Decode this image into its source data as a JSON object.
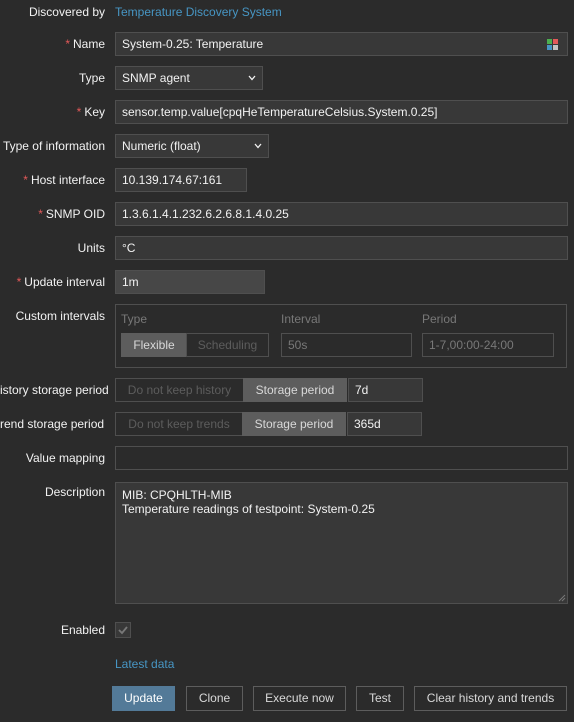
{
  "form": {
    "discovered_by": {
      "label": "Discovered by",
      "value": "Temperature Discovery System"
    },
    "name": {
      "label": "Name",
      "value": "System-0.25: Temperature"
    },
    "type": {
      "label": "Type",
      "value": "SNMP agent"
    },
    "key": {
      "label": "Key",
      "value": "sensor.temp.value[cpqHeTemperatureCelsius.System.0.25]"
    },
    "type_of_information": {
      "label": "Type of information",
      "value": "Numeric (float)"
    },
    "host_interface": {
      "label": "Host interface",
      "value": "10.139.174.67:161"
    },
    "snmp_oid": {
      "label": "SNMP OID",
      "value": "1.3.6.1.4.1.232.6.2.6.8.1.4.0.25"
    },
    "units": {
      "label": "Units",
      "value": "°C"
    },
    "update_interval": {
      "label": "Update interval",
      "value": "1m"
    },
    "custom_intervals": {
      "label": "Custom intervals",
      "headers": {
        "type": "Type",
        "interval": "Interval",
        "period": "Period"
      },
      "type_options": [
        "Flexible",
        "Scheduling"
      ],
      "interval_value": "50s",
      "period_value": "1-7,00:00-24:00"
    },
    "history_storage": {
      "label": "istory storage period",
      "options": [
        "Do not keep history",
        "Storage period"
      ],
      "value": "7d"
    },
    "trend_storage": {
      "label": "rend storage period",
      "options": [
        "Do not keep trends",
        "Storage period"
      ],
      "value": "365d"
    },
    "value_mapping": {
      "label": "Value mapping",
      "value": ""
    },
    "description": {
      "label": "Description",
      "value": "MIB: CPQHLTH-MIB\nTemperature readings of testpoint: System-0.25"
    },
    "enabled": {
      "label": "Enabled",
      "checked": true
    },
    "latest_data_link": "Latest data"
  },
  "buttons": {
    "update": "Update",
    "clone": "Clone",
    "execute_now": "Execute now",
    "test": "Test",
    "clear": "Clear history and trends"
  },
  "colors": {
    "background": "#2b2b2b",
    "link": "#4796c4",
    "required": "#e45959",
    "primary_button": "#537a98"
  }
}
